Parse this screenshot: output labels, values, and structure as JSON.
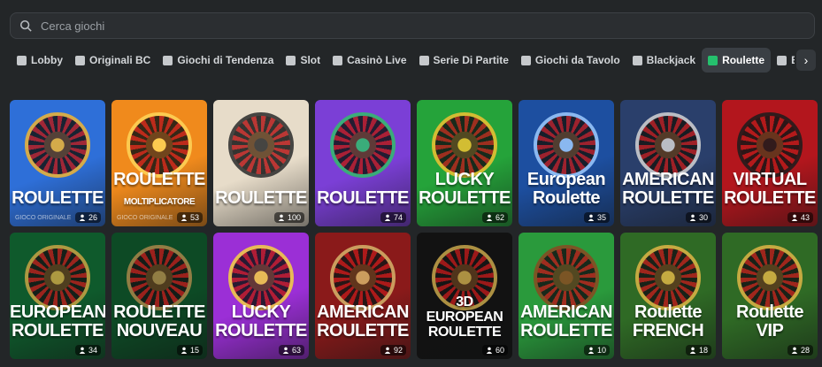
{
  "search": {
    "placeholder": "Cerca giochi"
  },
  "categories": [
    {
      "label": "Lobby",
      "icon": "home-icon"
    },
    {
      "label": "Originali BC",
      "icon": "originals-icon"
    },
    {
      "label": "Giochi di Tendenza",
      "icon": "fire-icon"
    },
    {
      "label": "Slot",
      "icon": "slot-icon"
    },
    {
      "label": "Casinò Live",
      "icon": "live-icon"
    },
    {
      "label": "Serie Di Partite",
      "icon": "series-icon"
    },
    {
      "label": "Giochi da Tavolo",
      "icon": "table-icon"
    },
    {
      "label": "Blackjack",
      "icon": "cards-icon"
    },
    {
      "label": "Roulette",
      "icon": "roulette-icon",
      "active": true
    },
    {
      "label": "Baccarat",
      "icon": "baccarat-icon"
    }
  ],
  "next_icon": "chevron-right-icon",
  "games": [
    {
      "title_lines": [
        "ROULETTE"
      ],
      "subtitle": "GIOCO ORIGINALE",
      "players": "26",
      "bg": "#2e6fd8",
      "accent": "#f2b632"
    },
    {
      "title_lines": [
        "ROULETTE",
        "MOLTIPLICATORE"
      ],
      "subtitle": "GIOCO ORIGINALE",
      "players": "53",
      "bg": "#f08a1c",
      "accent": "#ffd65a"
    },
    {
      "title_lines": [
        "ROULETTE"
      ],
      "subtitle": "",
      "players": "100",
      "bg": "#e7dcc9",
      "accent": "#2b2b2b"
    },
    {
      "title_lines": [
        "ROULETTE"
      ],
      "subtitle": "",
      "players": "74",
      "bg": "#7b3fd6",
      "accent": "#2fc06a"
    },
    {
      "title_lines": [
        "LUCKY",
        "ROULETTE"
      ],
      "subtitle": "",
      "players": "62",
      "bg": "#25a33a",
      "accent": "#f1c232"
    },
    {
      "title_lines": [
        "European",
        "Roulette"
      ],
      "subtitle": "",
      "players": "35",
      "bg": "#1d4fa0",
      "accent": "#9ecbff"
    },
    {
      "title_lines": [
        "AMERICAN",
        "ROULETTE"
      ],
      "subtitle": "",
      "players": "30",
      "bg": "#2a3f6b",
      "accent": "#d4d4d4"
    },
    {
      "title_lines": [
        "VIRTUAL",
        "ROULETTE"
      ],
      "subtitle": "",
      "players": "43",
      "bg": "#b3161d",
      "accent": "#1c1c1c"
    },
    {
      "title_lines": [
        "EUROPEAN",
        "ROULETTE"
      ],
      "subtitle": "",
      "players": "34",
      "bg": "#0f5a2c",
      "accent": "#c9a445"
    },
    {
      "title_lines": [
        "ROULETTE",
        "NOUVEAU"
      ],
      "subtitle": "",
      "players": "15",
      "bg": "#0d4a25",
      "accent": "#a9874a"
    },
    {
      "title_lines": [
        "LUCKY",
        "ROULETTE"
      ],
      "subtitle": "",
      "players": "63",
      "bg": "#9b2fd6",
      "accent": "#f5d342"
    },
    {
      "title_lines": [
        "AMERICAN",
        "ROULETTE"
      ],
      "subtitle": "",
      "players": "92",
      "bg": "#8a1a1a",
      "accent": "#d7b56a"
    },
    {
      "title_lines": [
        "3D",
        "EUROPEAN",
        "ROULETTE"
      ],
      "subtitle": "",
      "players": "60",
      "bg": "#121212",
      "accent": "#c8a64b"
    },
    {
      "title_lines": [
        "AMERICAN",
        "ROULETTE"
      ],
      "subtitle": "",
      "players": "10",
      "bg": "#2a9a3c",
      "accent": "#8a4a22"
    },
    {
      "title_lines": [
        "Roulette",
        "FRENCH"
      ],
      "subtitle": "",
      "players": "18",
      "bg": "#2f6a25",
      "accent": "#e0b646"
    },
    {
      "title_lines": [
        "Roulette",
        "VIP"
      ],
      "subtitle": "",
      "players": "28",
      "bg": "#2f6a25",
      "accent": "#e0b646"
    }
  ]
}
